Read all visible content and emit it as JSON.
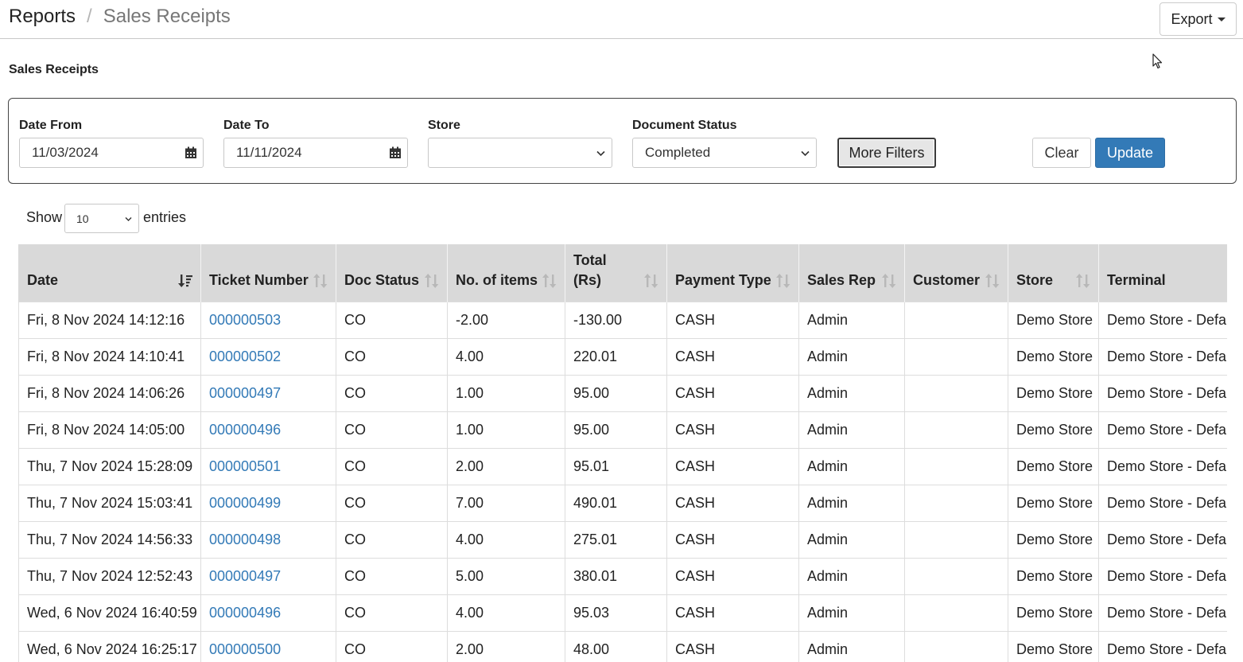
{
  "breadcrumb": {
    "root": "Reports",
    "separator": "/",
    "current": "Sales Receipts"
  },
  "export_label": "Export",
  "page_subtitle": "Sales Receipts",
  "filters": {
    "date_from": {
      "label": "Date From",
      "value": "11/03/2024"
    },
    "date_to": {
      "label": "Date To",
      "value": "11/11/2024"
    },
    "store": {
      "label": "Store",
      "value": ""
    },
    "document_status": {
      "label": "Document Status",
      "value": "Completed"
    },
    "more_filters_label": "More Filters",
    "clear_label": "Clear",
    "update_label": "Update"
  },
  "entries": {
    "show_label": "Show",
    "value": "10",
    "suffix": "entries"
  },
  "table": {
    "headers": {
      "date": "Date",
      "ticket": "Ticket Number",
      "doc_status": "Doc Status",
      "items": "No. of items",
      "total_line1": "Total",
      "total_line2": "(Rs)",
      "payment": "Payment Type",
      "sales_rep": "Sales Rep",
      "customer": "Customer",
      "store": "Store",
      "terminal": "Terminal"
    },
    "rows": [
      {
        "date": "Fri, 8 Nov 2024 14:12:16",
        "ticket": "000000503",
        "status": "CO",
        "items": "-2.00",
        "total": "-130.00",
        "payment": "CASH",
        "rep": "Admin",
        "customer": "",
        "store": "Demo Store",
        "terminal": "Demo Store - Default"
      },
      {
        "date": "Fri, 8 Nov 2024 14:10:41",
        "ticket": "000000502",
        "status": "CO",
        "items": "4.00",
        "total": "220.01",
        "payment": "CASH",
        "rep": "Admin",
        "customer": "",
        "store": "Demo Store",
        "terminal": "Demo Store - Default"
      },
      {
        "date": "Fri, 8 Nov 2024 14:06:26",
        "ticket": "000000497",
        "status": "CO",
        "items": "1.00",
        "total": "95.00",
        "payment": "CASH",
        "rep": "Admin",
        "customer": "",
        "store": "Demo Store",
        "terminal": "Demo Store - Default"
      },
      {
        "date": "Fri, 8 Nov 2024 14:05:00",
        "ticket": "000000496",
        "status": "CO",
        "items": "1.00",
        "total": "95.00",
        "payment": "CASH",
        "rep": "Admin",
        "customer": "",
        "store": "Demo Store",
        "terminal": "Demo Store - Default"
      },
      {
        "date": "Thu, 7 Nov 2024 15:28:09",
        "ticket": "000000501",
        "status": "CO",
        "items": "2.00",
        "total": "95.01",
        "payment": "CASH",
        "rep": "Admin",
        "customer": "",
        "store": "Demo Store",
        "terminal": "Demo Store - Default"
      },
      {
        "date": "Thu, 7 Nov 2024 15:03:41",
        "ticket": "000000499",
        "status": "CO",
        "items": "7.00",
        "total": "490.01",
        "payment": "CASH",
        "rep": "Admin",
        "customer": "",
        "store": "Demo Store",
        "terminal": "Demo Store - Default"
      },
      {
        "date": "Thu, 7 Nov 2024 14:56:33",
        "ticket": "000000498",
        "status": "CO",
        "items": "4.00",
        "total": "275.01",
        "payment": "CASH",
        "rep": "Admin",
        "customer": "",
        "store": "Demo Store",
        "terminal": "Demo Store - Default"
      },
      {
        "date": "Thu, 7 Nov 2024 12:52:43",
        "ticket": "000000497",
        "status": "CO",
        "items": "5.00",
        "total": "380.01",
        "payment": "CASH",
        "rep": "Admin",
        "customer": "",
        "store": "Demo Store",
        "terminal": "Demo Store - Default"
      },
      {
        "date": "Wed, 6 Nov 2024 16:40:59",
        "ticket": "000000496",
        "status": "CO",
        "items": "4.00",
        "total": "95.03",
        "payment": "CASH",
        "rep": "Admin",
        "customer": "",
        "store": "Demo Store",
        "terminal": "Demo Store - Default"
      },
      {
        "date": "Wed, 6 Nov 2024 16:25:17",
        "ticket": "000000500",
        "status": "CO",
        "items": "2.00",
        "total": "48.00",
        "payment": "CASH",
        "rep": "Admin",
        "customer": "",
        "store": "Demo Store",
        "terminal": "Demo Store - Default"
      }
    ]
  },
  "colors": {
    "link": "#337ab7",
    "primary": "#337ab7",
    "header_bg": "#d9d9d9"
  }
}
